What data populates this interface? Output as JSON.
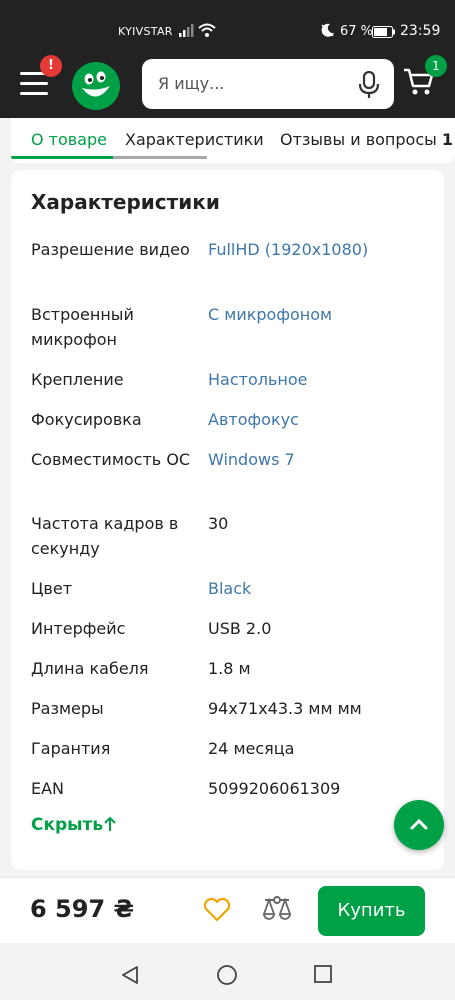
{
  "status_bar": {
    "carrier": "KYIVSTAR",
    "battery": "67 %",
    "time": "23:59"
  },
  "header": {
    "menu_badge": "!",
    "search_placeholder": "Я ищу...",
    "cart_count": "1",
    "accent_color": "#00a046"
  },
  "tabs": [
    {
      "label": "О товаре",
      "active": true
    },
    {
      "label": "Характеристики",
      "active": false
    },
    {
      "label": "Отзывы и вопросы",
      "active": false
    }
  ],
  "tabs_overflow_count": "1",
  "specs": {
    "title": "Характеристики",
    "rows": [
      {
        "label": "Разрешение видео",
        "value": "FullHD (1920x1080)",
        "link": true
      },
      {
        "label": "Встроенный микрофон",
        "value": "С микрофоном",
        "link": true
      },
      {
        "label": "Крепление",
        "value": "Настольное",
        "link": true
      },
      {
        "label": "Фокусировка",
        "value": "Автофокус",
        "link": true
      },
      {
        "label": "Совместимость ОС",
        "value": "Windows 7",
        "link": true
      },
      {
        "label": "Частота кадров в секунду",
        "value": "30",
        "link": false
      },
      {
        "label": "Цвет",
        "value": "Black",
        "link": true
      },
      {
        "label": "Интерфейс",
        "value": "USB 2.0",
        "link": false
      },
      {
        "label": "Длина кабеля",
        "value": "1.8 м",
        "link": false
      },
      {
        "label": "Размеры",
        "value": "94x71x43.3 мм мм",
        "link": false
      },
      {
        "label": "Гарантия",
        "value": "24 месяца",
        "link": false
      },
      {
        "label": "EAN",
        "value": "5099206061309",
        "link": false
      }
    ],
    "hide_label": "Скрыть"
  },
  "buy_bar": {
    "price": "6 597 ₴",
    "buy_label": "Купить"
  }
}
